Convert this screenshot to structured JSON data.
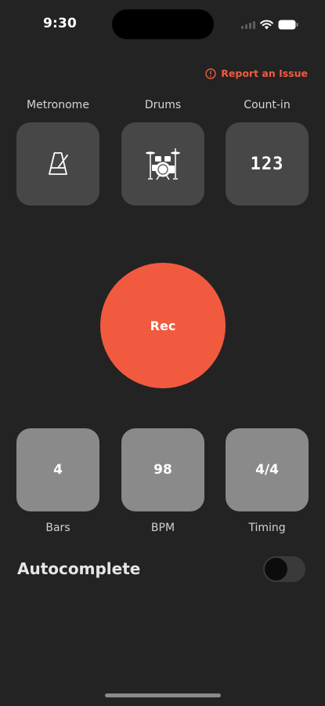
{
  "status_bar": {
    "time": "9:30",
    "icons": [
      "signal-icon",
      "wifi-icon",
      "battery-icon"
    ]
  },
  "report": {
    "label": "Report an Issue",
    "icon": "alert-circle-icon",
    "color": "#f15b3e"
  },
  "tools": [
    {
      "label": "Metronome",
      "icon": "metronome-icon"
    },
    {
      "label": "Drums",
      "icon": "drum-kit-icon"
    },
    {
      "label": "Count-in",
      "icon_text": "123"
    }
  ],
  "record": {
    "label": "Rec",
    "color": "#f25a3f"
  },
  "settings": [
    {
      "value": "4",
      "label": "Bars"
    },
    {
      "value": "98",
      "label": "BPM"
    },
    {
      "value": "4/4",
      "label": "Timing"
    }
  ],
  "autocomplete": {
    "label": "Autocomplete",
    "enabled": false
  },
  "colors": {
    "background": "#232323",
    "tool_tile": "#474747",
    "setting_tile": "#8a8a8a"
  }
}
